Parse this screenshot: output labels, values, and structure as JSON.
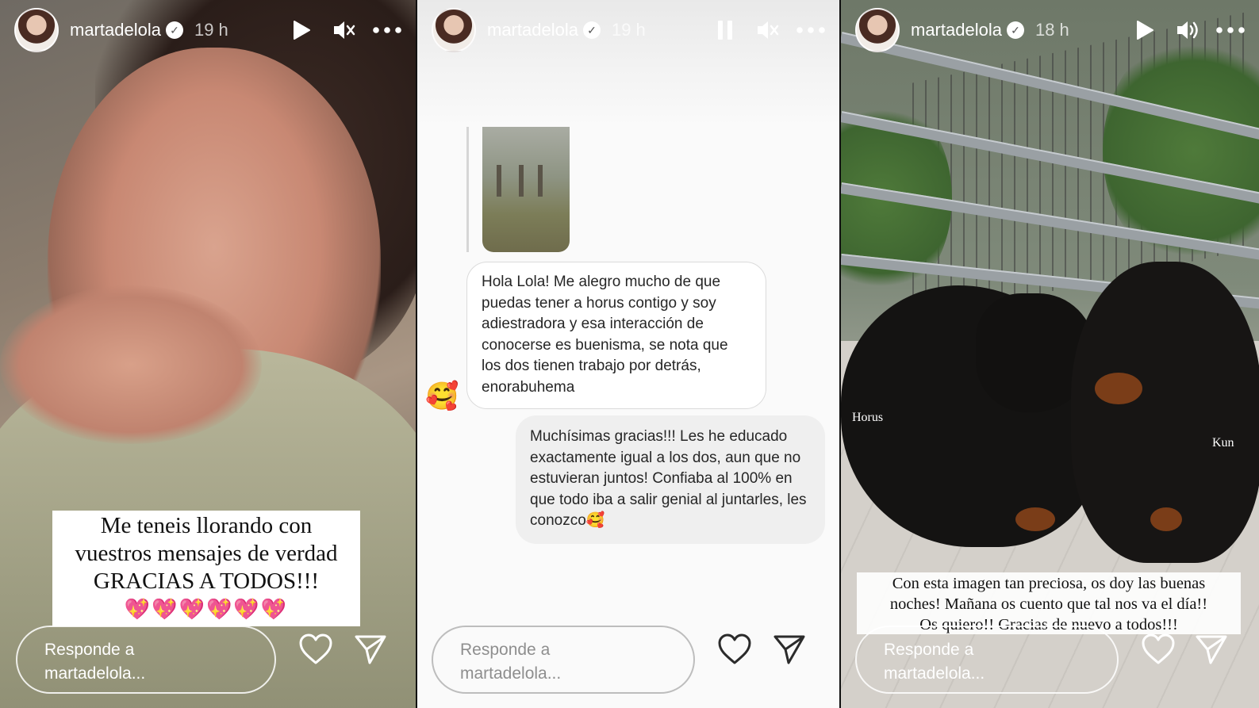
{
  "stories": [
    {
      "username": "martadelola",
      "time": "19 h",
      "caption": [
        "Me teneis llorando con",
        "vuestros mensajes de verdad",
        "GRACIAS A TODOS!!!"
      ],
      "hearts": "💖💖💖💖💖💖",
      "reply_placeholder": [
        "Responde a",
        "martadelola..."
      ]
    },
    {
      "username": "martadelola",
      "time": "19 h",
      "message_in": "Hola Lola! Me alegro mucho de que puedas tener a horus contigo y soy adiestradora y esa interacción de conocerse es buenisma, se nota que los dos tienen trabajo por detrás, enorabuhema",
      "reaction_emoji": "🥰",
      "message_out": "Muchísimas gracias!!! Les he educado exactamente igual a los dos, aun que no estuvieran juntos! Confiaba al 100% en que todo iba a salir genial al juntarles, les conozco🥰",
      "reply_placeholder": [
        "Responde a",
        "martadelola..."
      ]
    },
    {
      "username": "martadelola",
      "time": "18 h",
      "dog_labels": [
        "Horus",
        "Kun"
      ],
      "caption": [
        "Con esta imagen tan preciosa, os doy las buenas",
        "noches! Mañana os cuento que tal nos va el día!!",
        "Os quiero!! Gracias de nuevo a todos!!!"
      ],
      "reply_placeholder": [
        "Responde a",
        "martadelola..."
      ]
    }
  ],
  "icons": {
    "verified": "verified-badge-icon",
    "play": "play-icon",
    "pause": "pause-icon",
    "muted": "speaker-muted-icon",
    "sound": "speaker-on-icon",
    "more": "more-dots-icon",
    "like": "heart-icon",
    "share": "send-icon"
  }
}
